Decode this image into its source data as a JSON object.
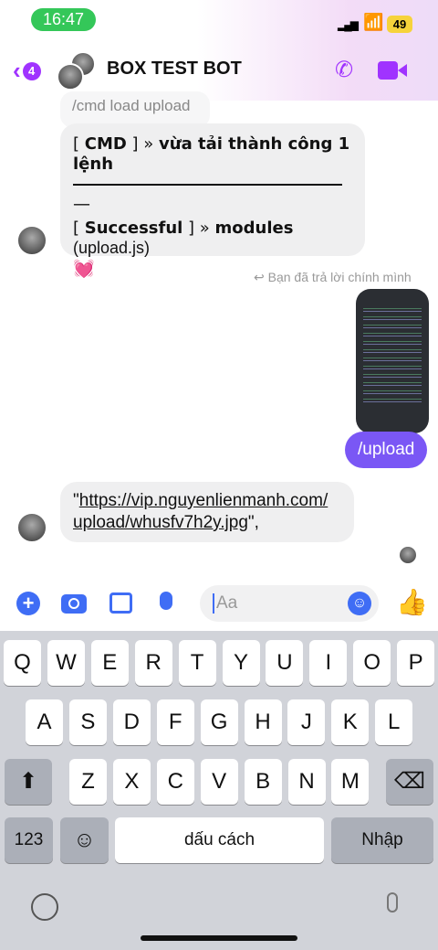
{
  "status": {
    "time": "16:47",
    "battery": "49"
  },
  "header": {
    "unread": "4",
    "title": "BOX TEST BOT"
  },
  "messages": {
    "reply_quote": "/cmd load upload",
    "bot_line1_bracket_open": "[ ",
    "bot_line1_cmd": "CMD",
    "bot_line1_rest": " ] » ",
    "bot_line1_bold": "vừa tải thành công 1 lệnh",
    "divider_dash": "—",
    "bot_line2_open": "[ ",
    "bot_line2_bold": "Successful",
    "bot_line2_mid": " ] » ",
    "bot_line2_modules": "modules",
    "bot_line2_file": " (upload.js)",
    "emoji": "💓",
    "reply_note": "Bạn đã trả lời chính mình",
    "user_message": "/upload",
    "link_prefix": "\"",
    "link_line1": "https://vip.nguyenlienmanh.com/",
    "link_line2": "upload/whusfv7h2y.jpg",
    "link_suffix": "\","
  },
  "composer": {
    "placeholder": "Aa"
  },
  "keyboard": {
    "row1": [
      "Q",
      "W",
      "E",
      "R",
      "T",
      "Y",
      "U",
      "I",
      "O",
      "P"
    ],
    "row2": [
      "A",
      "S",
      "D",
      "F",
      "G",
      "H",
      "J",
      "K",
      "L"
    ],
    "row3": [
      "Z",
      "X",
      "C",
      "V",
      "B",
      "N",
      "M"
    ],
    "numbers": "123",
    "space": "dấu cách",
    "enter": "Nhập"
  },
  "colors": {
    "accent": "#a033ff",
    "bubble_user": "#7a57f5"
  }
}
